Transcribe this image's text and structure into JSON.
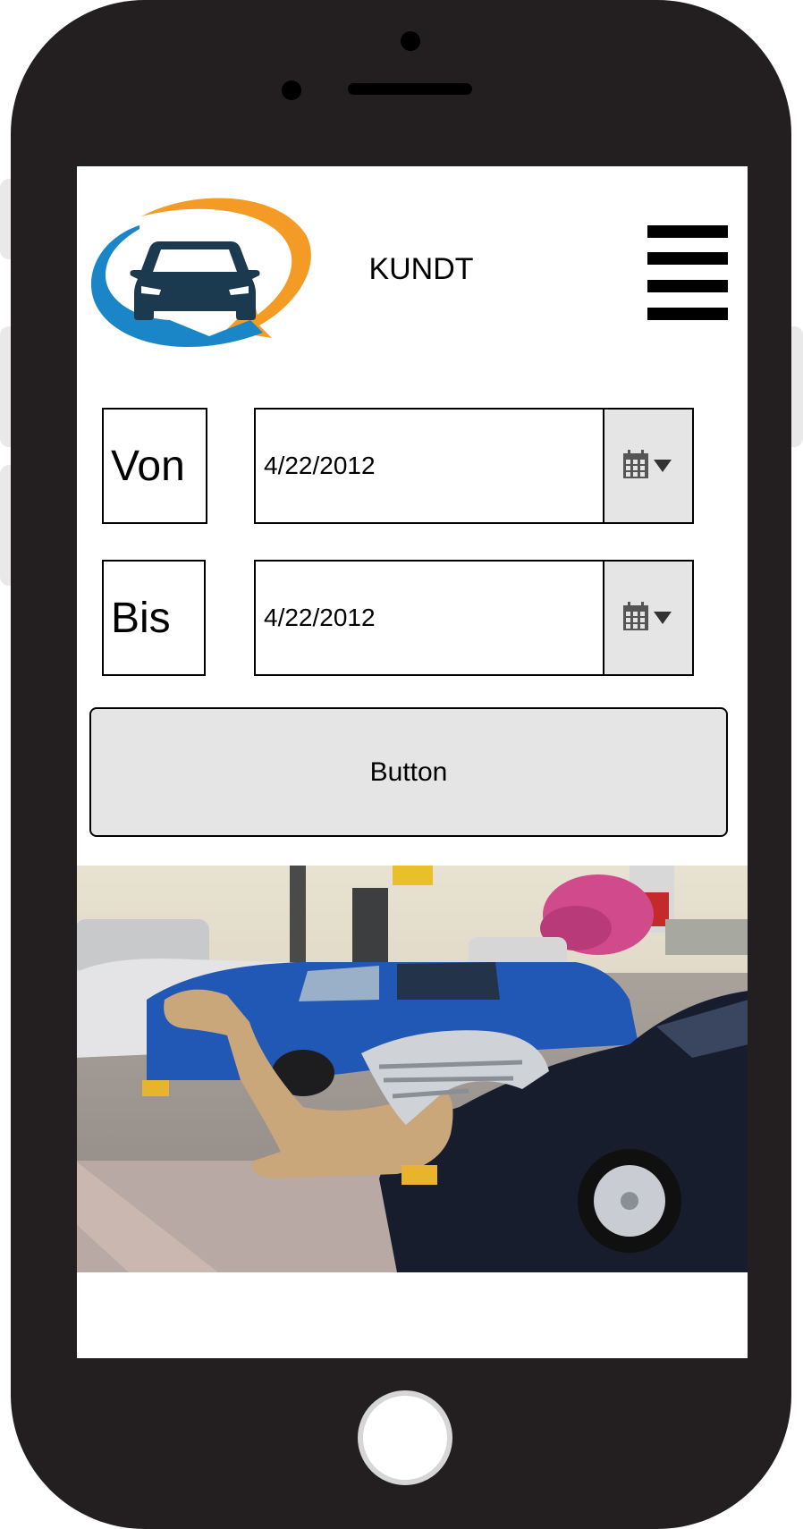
{
  "header": {
    "title": "KUNDT",
    "logo_icon": "car-sync-logo",
    "menu_icon": "hamburger-menu-icon"
  },
  "form": {
    "from_label": "Von",
    "from_date": "4/22/2012",
    "to_label": "Bis",
    "to_date": "4/22/2012",
    "picker_icon": "calendar-icon"
  },
  "action_button": {
    "label": "Button"
  },
  "photo": {
    "subject": "camel-resting-among-parked-cars"
  },
  "colors": {
    "device_frame": "#231f20",
    "logo_orange": "#f39b24",
    "logo_blue": "#1a86c8",
    "logo_car": "#1b3a4f",
    "control_gray": "#e5e5e5"
  }
}
